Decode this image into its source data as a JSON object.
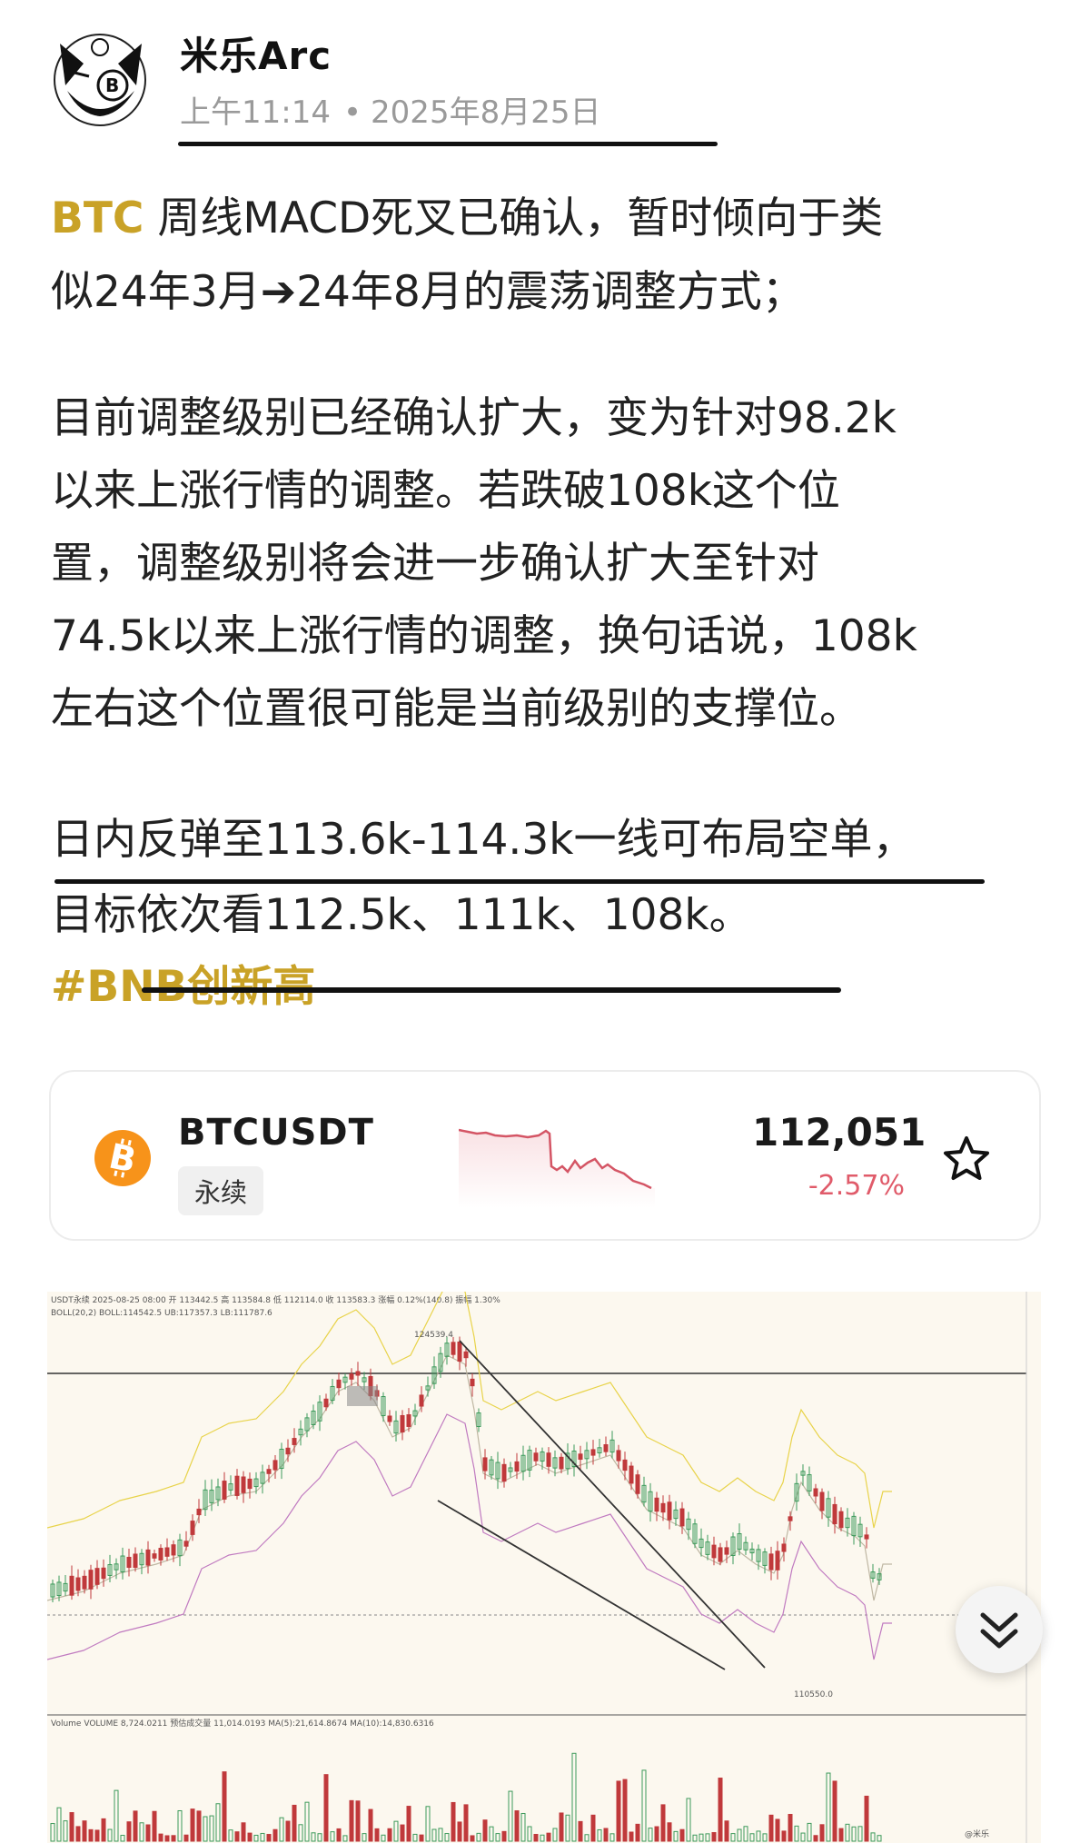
{
  "post": {
    "author": "米乐Arc",
    "time": "上午11:14",
    "date": "2025年8月25日",
    "p1_tag": "BTC",
    "p1_line1": " 周线MACD死叉已确认，暂时倾向于类",
    "p1_line2": "似24年3月➔24年8月的震荡调整方式；",
    "p2_lines": [
      "目前调整级别已经确认扩大，变为针对98.2k",
      "以来上涨行情的调整。若跌破108k这个位",
      "置，调整级别将会进一步确认扩大至针对",
      "74.5k以来上涨行情的调整，换句话说，108k",
      "左右这个位置很可能是当前级别的支撑位。"
    ],
    "p3_lines": [
      "日内反弹至113.6k-114.3k一线可布局空单，",
      "目标依次看112.5k、111k、108k。"
    ],
    "hashtag": "#BNB创新高"
  },
  "ticker": {
    "symbol": "BTCUSDT",
    "type_label": "永续",
    "price": "112,051",
    "change": "-2.57%",
    "logo_icon": "bitcoin-icon",
    "change_color": "#e05b6a"
  },
  "chart_screenshot": {
    "header_line": "USDT永续 2025-08-25 08:00 开 113442.5 高 113584.8 低 112114.0 收 113583.3 涨幅 0.12%(140.8) 振幅 1.30%",
    "boll_line": "BOLL(20,2) BOLL:114542.5 UB:117357.3 LB:111787.6",
    "high_label": "124539.4",
    "low_label": "110550.0",
    "volume_line": "Volume VOLUME 8,724.0211 预估成交量 11,014.0193 MA(5):21,614.8674 MA(10):14,830.6316",
    "watermark": "@米乐"
  },
  "colors": {
    "accent_gold": "#c9a227",
    "bull": "#3d9a5b",
    "bear": "#c0393b"
  }
}
